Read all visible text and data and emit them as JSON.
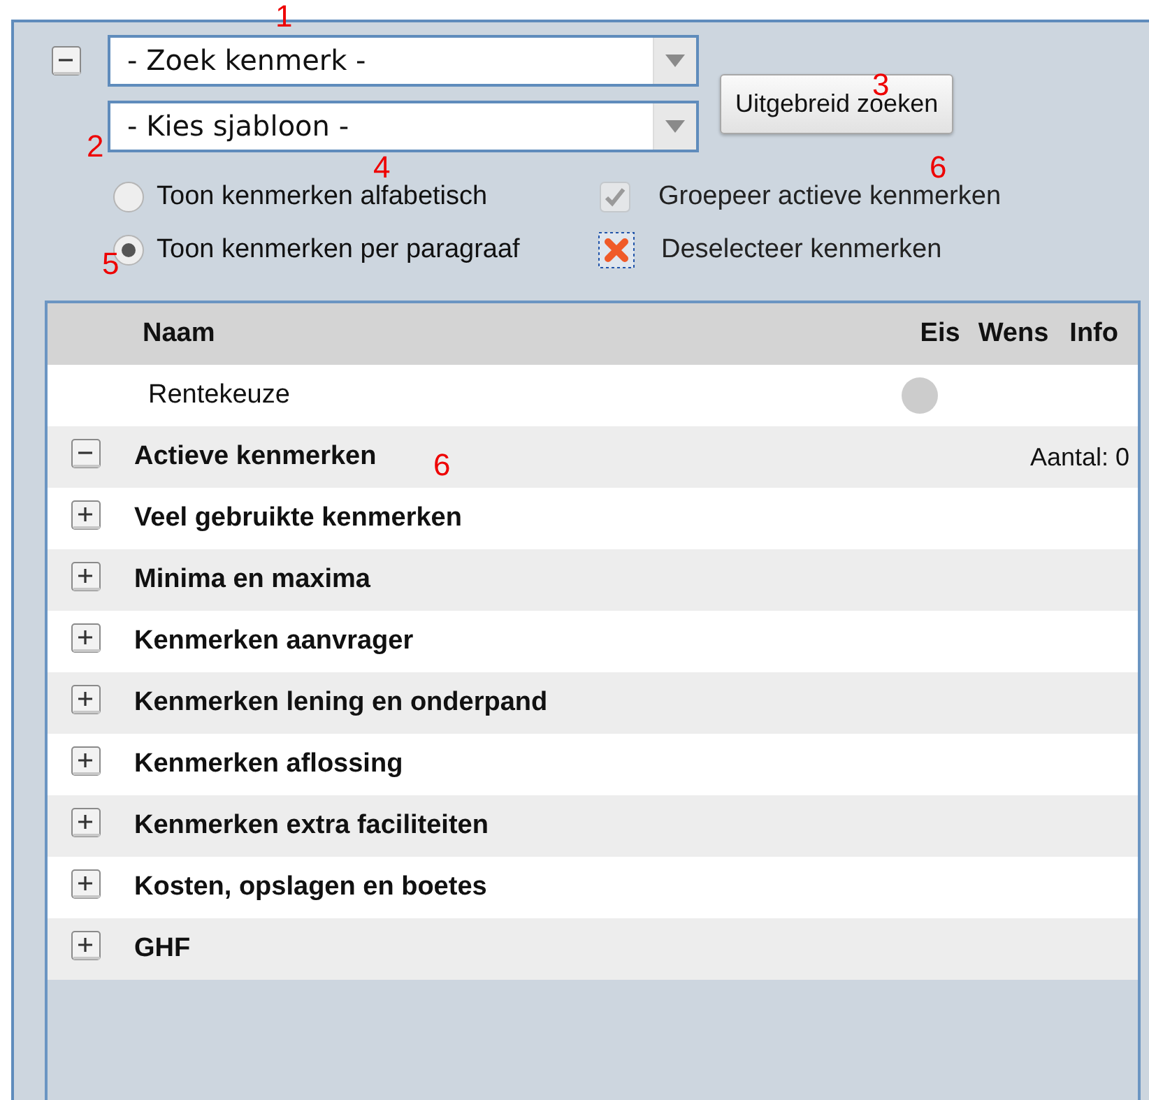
{
  "search_panel": {
    "expanded": true,
    "search": {
      "value": "- Zoek kenmerk -"
    },
    "template": {
      "value": "- Kies sjabloon -"
    },
    "advanced_button": "Uitgebreid zoeken"
  },
  "view_options": [
    {
      "label": "Toon kenmerken alfabetisch",
      "selected": false
    },
    {
      "label": "Toon kenmerken per paragraaf",
      "selected": true
    }
  ],
  "group_active": {
    "label": "Groepeer actieve kenmerken",
    "checked": true,
    "disabled": true
  },
  "deselect": {
    "label": "Deselecteer kenmerken"
  },
  "table": {
    "columns": [
      "Naam",
      "Eis",
      "Wens",
      "Info"
    ],
    "rows": [
      {
        "kind": "item",
        "name": "Rentekeuze",
        "required": false
      },
      {
        "kind": "group",
        "name": "Actieve kenmerken",
        "expanded": true,
        "count": "Aantal: 0"
      },
      {
        "kind": "group",
        "name": "Veel gebruikte kenmerken",
        "expanded": false
      },
      {
        "kind": "group",
        "name": "Minima en maxima",
        "expanded": false
      },
      {
        "kind": "group",
        "name": "Kenmerken aanvrager",
        "expanded": false
      },
      {
        "kind": "group",
        "name": "Kenmerken lening en onderpand",
        "expanded": false
      },
      {
        "kind": "group",
        "name": "Kenmerken aflossing",
        "expanded": false
      },
      {
        "kind": "group",
        "name": "Kenmerken extra faciliteiten",
        "expanded": false
      },
      {
        "kind": "group",
        "name": "Kosten, opslagen en boetes",
        "expanded": false
      },
      {
        "kind": "group",
        "name": "GHF",
        "expanded": false
      }
    ]
  },
  "annotations": [
    {
      "text": "1"
    },
    {
      "text": "2"
    },
    {
      "text": "3"
    },
    {
      "text": "4"
    },
    {
      "text": "5"
    },
    {
      "text": "6"
    },
    {
      "text": "6"
    }
  ]
}
